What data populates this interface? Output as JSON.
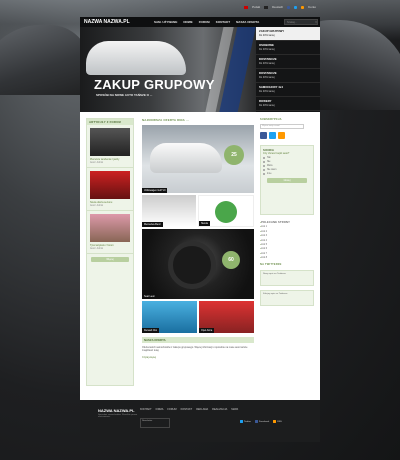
{
  "topbar": {
    "lang1": "Polski",
    "lang2": "Deutsch",
    "account": "Konto"
  },
  "nav": {
    "logo": "NAZWA NAZWA.PL",
    "items": [
      "SAM. UŻYWANE",
      "NOWE",
      "FORUM",
      "KONTAKT",
      "NASZA OFERTA"
    ],
    "search_placeholder": "Szukaj..."
  },
  "hero": {
    "title": "ZAKUP GRUPOWY",
    "subtitle": "SPOSÓB NA NOWE AUTO TAŃSZE O ..."
  },
  "side_list": [
    {
      "title": "ZAKUP GRUPOWY",
      "text": "Do 40% taniej"
    },
    {
      "title": "OSOBOWE",
      "text": "Do 40% taniej"
    },
    {
      "title": "DOSTAWCZE",
      "text": "Do 40% taniej"
    },
    {
      "title": "DOSTAWCZE",
      "text": "Do 40% taniej"
    },
    {
      "title": "SAMOCHODY 4x4",
      "text": "Do 40% taniej"
    },
    {
      "title": "ROWERY",
      "text": "Do 40% taniej"
    }
  ],
  "left_col": {
    "header": "ARTYKUŁY Z FORUM",
    "items": [
      {
        "title": "Pierwsze wrażenia z jazdy",
        "meta": "Autor: Admin"
      },
      {
        "title": "Nowa oferta sezonu",
        "meta": "Autor: Admin"
      },
      {
        "title": "Tytuł artykułu z forum",
        "meta": "Autor: Admin"
      }
    ],
    "more": "Więcej"
  },
  "main": {
    "header": "NAJNOWSZA OFERTA DNIA ...",
    "big_caption": "Volkswagen Golf VII",
    "badge1": "25",
    "row2": [
      "Mercedes-Benz",
      "Skoda"
    ],
    "wide_caption": "Seat Leon",
    "badge2": "60",
    "row3": [
      "Renault Clio",
      "Opel Astra"
    ],
    "bottom_header": "NASZA OFERTA",
    "paragraph": "Oferta tanich samochodów z zakupu grupowego. Więcej informacji o sposobie na nowe auto tańsze znajdziesz tutaj.",
    "read_more": "Czytaj więcej"
  },
  "right_col": {
    "header": "SUBSKRYPCJA",
    "email_placeholder": "Wpisz swój e-mail",
    "sonda_header": "SONDA",
    "sonda_q": "Czy chcesz kupić auto?",
    "options": [
      "Tak",
      "Nie",
      "Może",
      "Nie wiem",
      "Inne"
    ],
    "vote": "Głosuj",
    "links_header": "POLECANE STRONY",
    "links": [
      "Link 1",
      "Link 2",
      "Link 3",
      "Link 4",
      "Link 5",
      "Link 6",
      "Link 7",
      "Link 8"
    ],
    "tw_header": "NA TWITTERZE",
    "tweets": [
      "Nowy wpis na Twitterze",
      "Kolejny wpis na Twitterze"
    ]
  },
  "footer": {
    "logo": "NAZWA NAZWA.PL",
    "text": "Sprzedaż samochodów. Wszelkie prawa zastrzeżone.",
    "nav": [
      "KONTAKT",
      "FIRMA",
      "FORUM",
      "KONTAKT",
      "REKLAMA",
      "REALIZACJA",
      "MAPA"
    ],
    "box": "Newsletter",
    "social": [
      "Twitter",
      "Facebook",
      "RSS"
    ]
  }
}
